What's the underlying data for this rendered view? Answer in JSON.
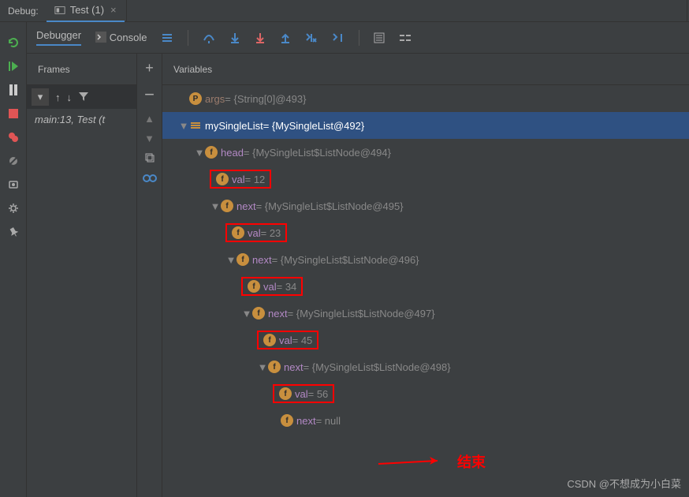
{
  "header": {
    "debug_label": "Debug:",
    "tab_name": "Test (1)",
    "tab_close": "×"
  },
  "subtabs": {
    "debugger": "Debugger",
    "console": "Console"
  },
  "frames": {
    "title": "Frames",
    "row": "main:13, Test (t"
  },
  "variables": {
    "title": "Variables",
    "args_name": "args",
    "args_value": " = {String[0]@493}",
    "list_name": "mySingleList",
    "list_value": " = {MySingleList@492}",
    "head_name": "head",
    "head_value": " = {MySingleList$ListNode@494}",
    "val1_name": "val",
    "val1_value": " = 12",
    "next1_name": "next",
    "next1_value": " = {MySingleList$ListNode@495}",
    "val2_name": "val",
    "val2_value": " = 23",
    "next2_name": "next",
    "next2_value": " = {MySingleList$ListNode@496}",
    "val3_name": "val",
    "val3_value": " = 34",
    "next3_name": "next",
    "next3_value": " = {MySingleList$ListNode@497}",
    "val4_name": "val",
    "val4_value": " = 45",
    "next4_name": "next",
    "next4_value": " = {MySingleList$ListNode@498}",
    "val5_name": "val",
    "val5_value": " = 56",
    "next5_name": "next",
    "next5_value": " = null"
  },
  "annotation": {
    "end_label": "结束"
  },
  "watermark": "CSDN @不想成为小白菜"
}
